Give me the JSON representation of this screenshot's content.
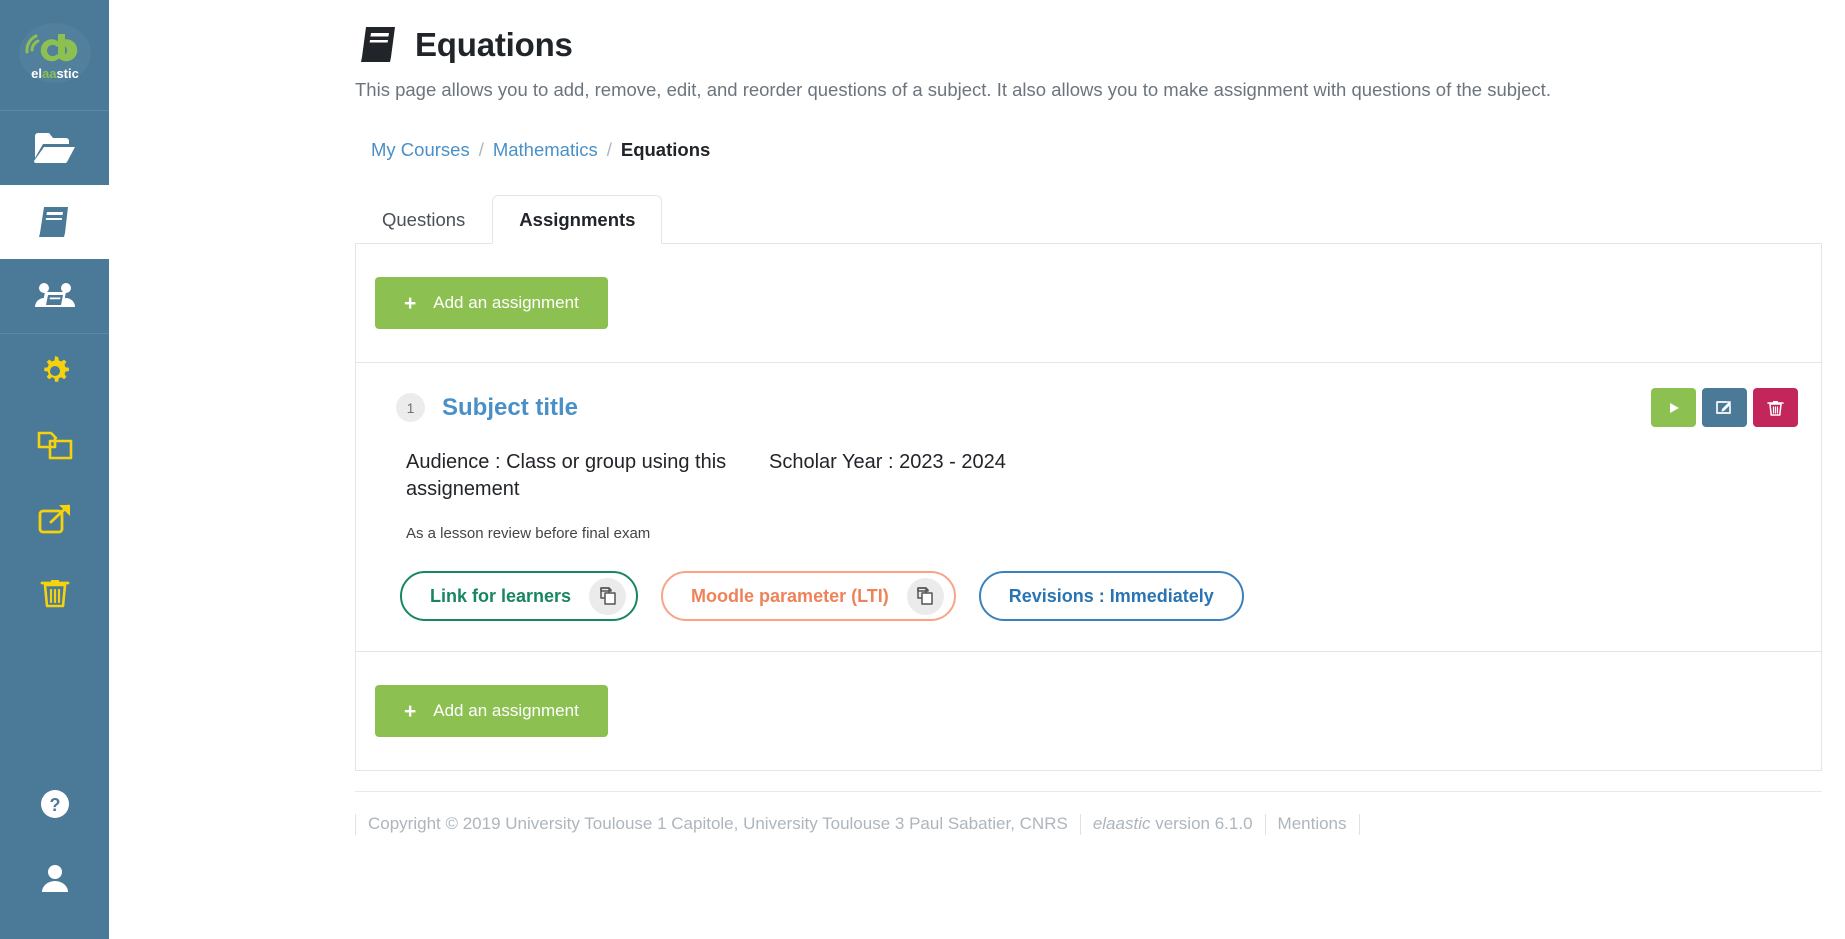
{
  "sidebar": {
    "logo": {
      "text_pre": "el",
      "text_mid": "aa",
      "text_post": "stic",
      "alt": "elaastic-logo"
    },
    "items": [
      {
        "name": "sidebar-item-folder",
        "icon": "folder-open-icon",
        "active": false
      },
      {
        "name": "sidebar-item-subjects",
        "icon": "book-icon",
        "active": true
      },
      {
        "name": "sidebar-item-shared",
        "icon": "book-group-icon",
        "active": false
      },
      {
        "name": "sidebar-item-settings",
        "icon": "gear-icon",
        "active": false
      },
      {
        "name": "sidebar-item-duplicate",
        "icon": "copy-icon",
        "active": false
      },
      {
        "name": "sidebar-item-external",
        "icon": "external-link-icon",
        "active": false
      },
      {
        "name": "sidebar-item-trash",
        "icon": "trash-icon",
        "active": false
      },
      {
        "name": "sidebar-item-help",
        "icon": "help-circle-icon",
        "active": false
      },
      {
        "name": "sidebar-item-account",
        "icon": "user-icon",
        "active": false
      }
    ]
  },
  "header": {
    "icon": "book-icon",
    "title": "Equations",
    "description": "This page allows you to add, remove, edit, and reorder questions of a subject. It also allows you to make assignment with questions of the subject."
  },
  "breadcrumb": {
    "items": [
      {
        "label": "My Courses",
        "current": false
      },
      {
        "label": "Mathematics",
        "current": false
      },
      {
        "label": "Equations",
        "current": true
      }
    ],
    "separator": "/"
  },
  "tabs": [
    {
      "label": "Questions",
      "active": false
    },
    {
      "label": "Assignments",
      "active": true
    }
  ],
  "actions": {
    "add_assignment_top": "Add an assignment",
    "add_assignment_bottom": "Add an assignment",
    "plus_glyph": "+"
  },
  "assignment": {
    "number": "1",
    "title": "Subject title",
    "audience": "Audience : Class or group using this assignement",
    "scholar_year": "Scholar Year : 2023 - 2024",
    "note": "As a lesson review before final exam",
    "buttons": {
      "play": {
        "name": "start-assignment-button",
        "icon": "play-icon"
      },
      "edit": {
        "name": "edit-assignment-button",
        "icon": "edit-square-icon"
      },
      "delete": {
        "name": "delete-assignment-button",
        "icon": "trash-icon"
      }
    },
    "pills": [
      {
        "label": "Link for learners",
        "copy": true,
        "style": "green"
      },
      {
        "label": "Moodle parameter (LTI)",
        "copy": true,
        "style": "orange"
      },
      {
        "label": "Revisions : Immediately",
        "copy": false,
        "style": "blue"
      }
    ]
  },
  "footer": {
    "copyright": "Copyright © 2019 University Toulouse 1 Capitole, University Toulouse 3 Paul Sabatier, CNRS",
    "version_brand": "elaastic",
    "version_text": " version 6.1.0",
    "mentions": "Mentions"
  },
  "colors": {
    "sidebar_bg": "#4a7a97",
    "accent_green": "#8cc152",
    "link_blue": "#4a90c7",
    "delete_red": "#c2265b",
    "icon_yellow": "#f5d20c",
    "pill_green": "#18875f",
    "pill_orange": "#f0825a",
    "pill_blue": "#2a74b4"
  }
}
